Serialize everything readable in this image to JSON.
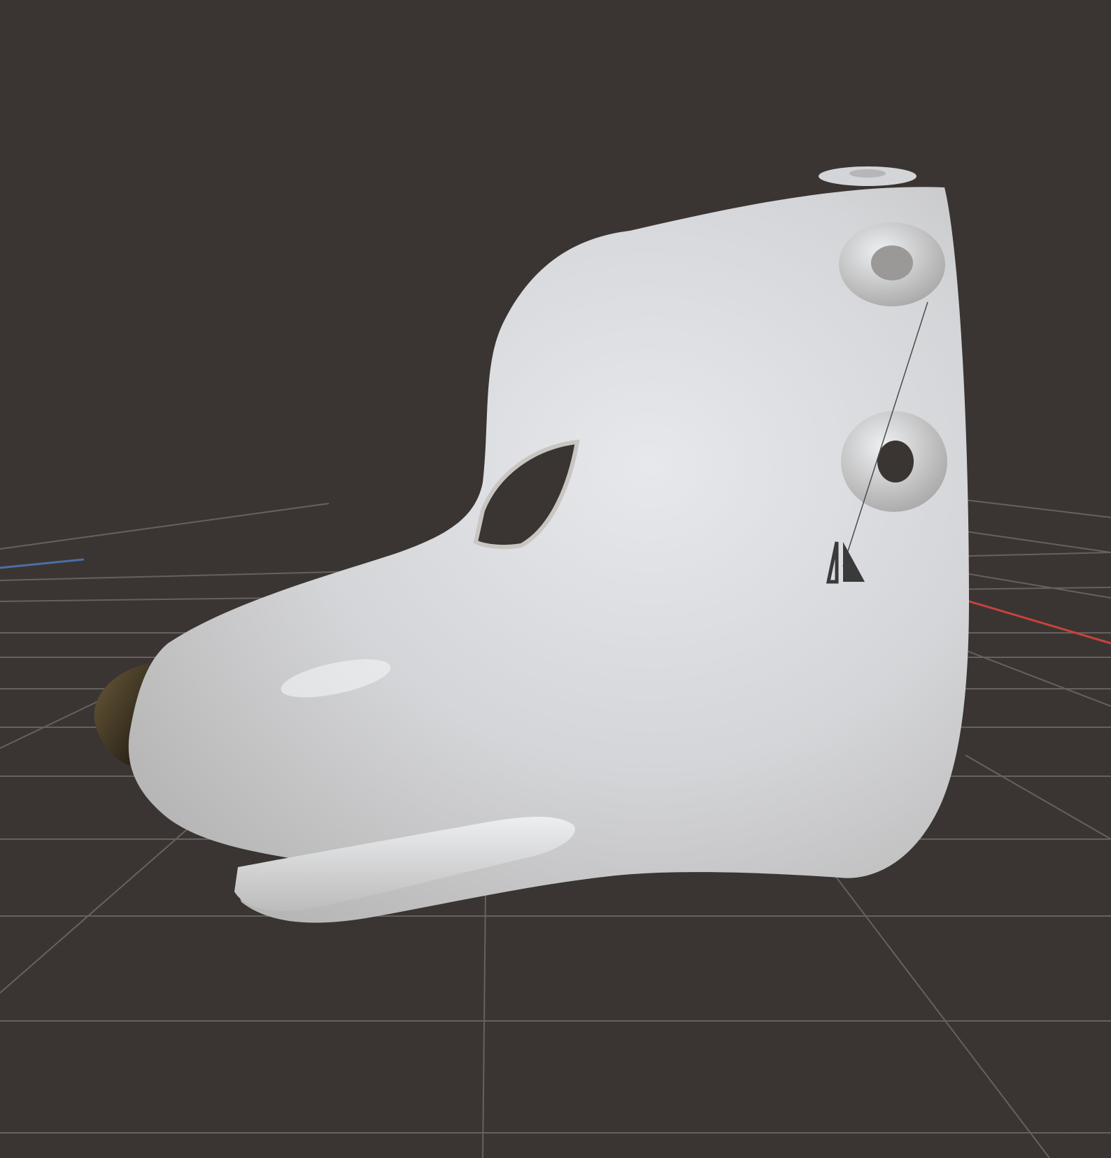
{
  "viewport": {
    "background_color": "#3a3532",
    "grid_color": "#8a8683",
    "x_axis_color": "#c8423d",
    "y_axis_color": "#4a6fa5",
    "model_color": "#d9dadd",
    "nose_color": "#2a2418"
  },
  "icons": {
    "mirror_gizmo": "mirror-symmetry-icon",
    "object_origin": "origin-line"
  }
}
